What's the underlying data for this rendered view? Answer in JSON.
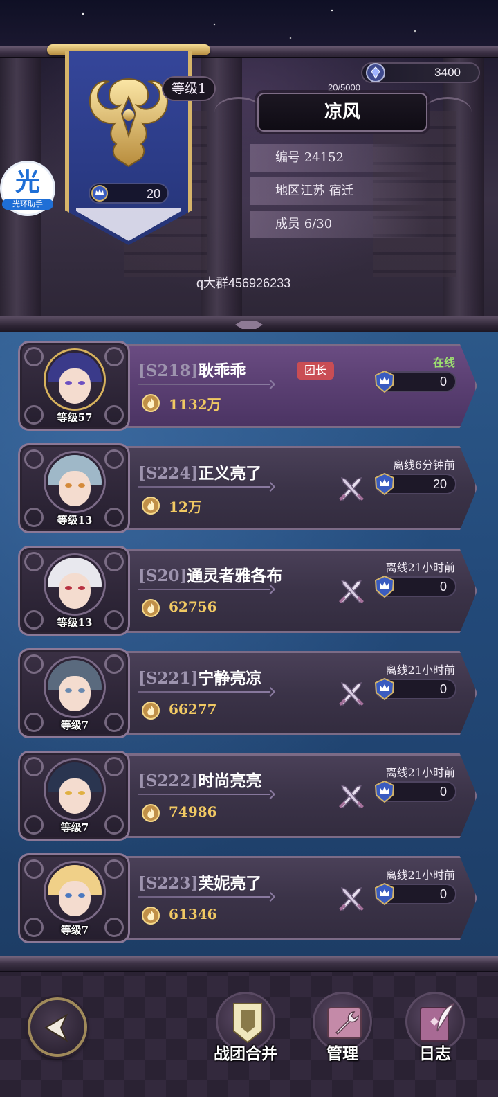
{
  "guild": {
    "level_label": "等级1",
    "name": "凉风",
    "exp": "20/5000",
    "currency": "3400",
    "banner_score": "20",
    "id_row": "编号 24152",
    "region_row": "地区江苏 宿迁",
    "members_row": "成员 6/30",
    "qq_group": "q大群456926233"
  },
  "helper": {
    "glyph": "光",
    "label": "光环助手"
  },
  "members": [
    {
      "server": "[S218]",
      "name": "耿乖乖",
      "level": "等级57",
      "power": "1132万",
      "status": "在线",
      "contribution": "0",
      "role": "团长",
      "hair": "#3a3a8a",
      "eye": "#6b4fc2"
    },
    {
      "server": "[S224]",
      "name": "正义亮了",
      "level": "等级13",
      "power": "12万",
      "status": "离线6分钟前",
      "contribution": "20",
      "hair": "#9fb8c8",
      "eye": "#d48a3a"
    },
    {
      "server": "[S20]",
      "name": "通灵者雅各布",
      "level": "等级13",
      "power": "62756",
      "status": "离线21小时前",
      "contribution": "0",
      "hair": "#e8e8ee",
      "eye": "#b83040"
    },
    {
      "server": "[S221]",
      "name": "宁静亮凉",
      "level": "等级7",
      "power": "66277",
      "status": "离线21小时前",
      "contribution": "0",
      "hair": "#5a6a7e",
      "eye": "#6a8ab0"
    },
    {
      "server": "[S222]",
      "name": "时尚亮亮",
      "level": "等级7",
      "power": "74986",
      "status": "离线21小时前",
      "contribution": "0",
      "hair": "#2a3550",
      "eye": "#e0b040"
    },
    {
      "server": "[S223]",
      "name": "芙妮亮了",
      "level": "等级7",
      "power": "61346",
      "status": "离线21小时前",
      "contribution": "0",
      "hair": "#f0d088",
      "eye": "#4a78c0"
    }
  ],
  "actions": {
    "merge": "战团合并",
    "manage": "管理",
    "log": "日志"
  },
  "colors": {
    "leader_tag": "#c94d54",
    "online": "#9de070",
    "power_gold": "#f1c963",
    "list_bg": "#234a7a"
  },
  "icons": {
    "currency": "blue-gem-icon",
    "contribution": "crown-shield-icon",
    "power": "flame-coin-icon",
    "swords": "crossed-swords-icon",
    "back": "back-arrow-icon",
    "merge": "banner-merge-icon",
    "manage": "wrench-icon",
    "log": "feather-book-icon"
  }
}
